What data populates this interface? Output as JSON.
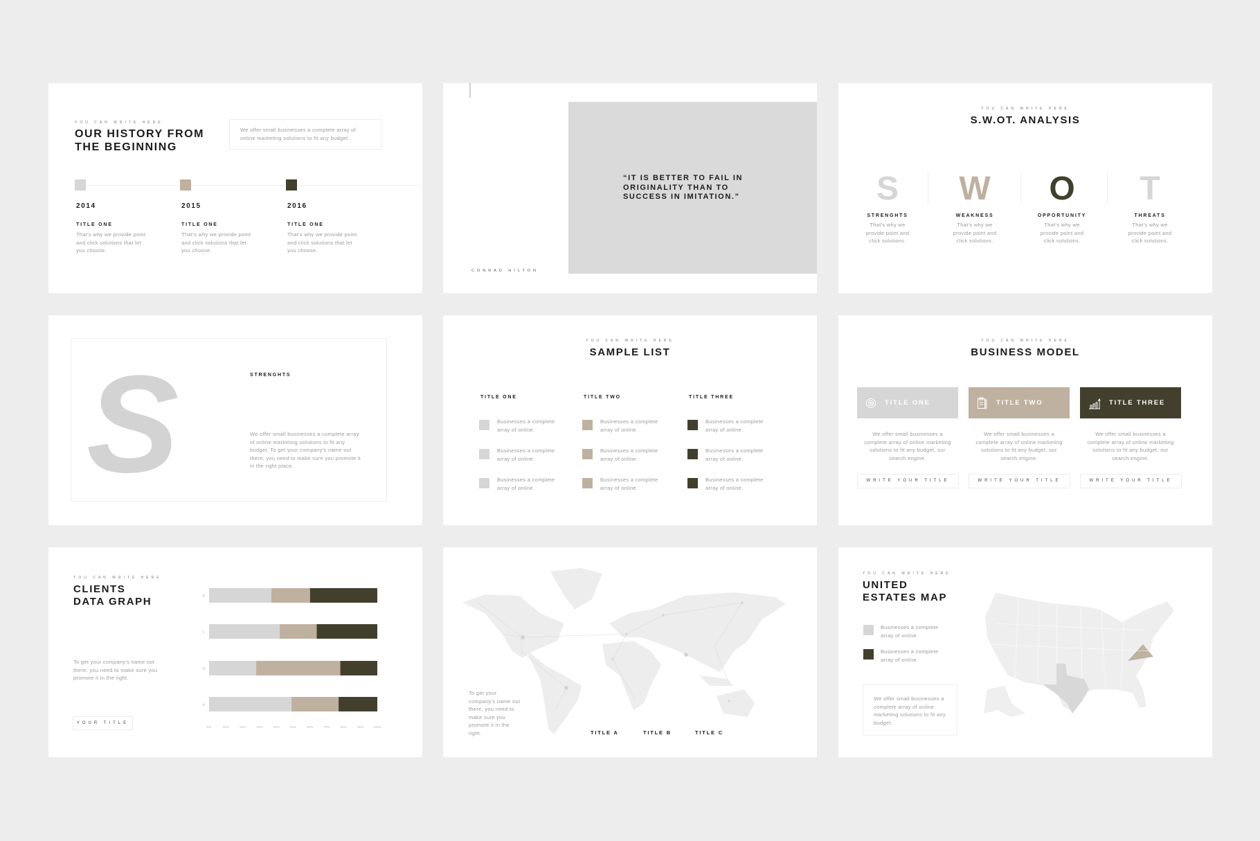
{
  "colors": {
    "background": "#eeedee",
    "light": "#d6d6d6",
    "beige": "#bfb19f",
    "dark": "#423f2d"
  },
  "kicker": "You can write here",
  "history": {
    "title_l1": "Our history from",
    "title_l2": "the beginning",
    "box_text": "We offer small businesses a complete array of online marketing solutions to fit any budget.",
    "items": [
      {
        "year": "2014",
        "title": "Title one",
        "text": "That's why we provide point and click solutions that let you choose."
      },
      {
        "year": "2015",
        "title": "Title one",
        "text": "That's why we provide point and click solutions that let you choose."
      },
      {
        "year": "2016",
        "title": "Title one",
        "text": "That's why we provide point and click solutions that let you choose."
      }
    ]
  },
  "quote": {
    "text": "“It is better to fail in originality than to success in imitation.”",
    "author": "Conrad Hilton"
  },
  "swot": {
    "title": "S.W.OT. Analysis",
    "items": [
      {
        "letter": "S",
        "label": "Strenghts",
        "text": "That's why we provide point and click solutions."
      },
      {
        "letter": "W",
        "label": "Weakness",
        "text": "That's why we provide point and click solutions."
      },
      {
        "letter": "O",
        "label": "Opportunity",
        "text": "That's why we provide point and click solutions."
      },
      {
        "letter": "T",
        "label": "Threats",
        "text": "That's why we provide point and click solutions."
      }
    ]
  },
  "strength": {
    "letter": "S",
    "label": "Strenghts",
    "text": "We offer small businesses a complete array of online marketing solutions to fit any budget. To get your company's name out there, you need to make sure you promote it in the right place."
  },
  "sample_list": {
    "title": "Sample list",
    "columns": [
      {
        "title": "Title one",
        "items": [
          "Businesses a complete array of online.",
          "Businesses a complete array of online.",
          "Businesses a complete array of online."
        ]
      },
      {
        "title": "Title two",
        "items": [
          "Businesses a complete array of online.",
          "Businesses a complete array of online.",
          "Businesses a complete array of online."
        ]
      },
      {
        "title": "Title three",
        "items": [
          "Businesses a complete array of online.",
          "Businesses a complete array of online.",
          "Businesses a complete array of online."
        ]
      }
    ]
  },
  "business": {
    "title": "Business model",
    "cards": [
      {
        "title": "Title one",
        "icon": "target-icon",
        "text": "We offer small businesses a complete array of online marketing solutions to fit any budget, our search engine.",
        "button": "Write your title"
      },
      {
        "title": "Title two",
        "icon": "clipboard-icon",
        "text": "We offer small businesses a complete array of online marketing solutions to fit any budget, our search engine.",
        "button": "Write your title"
      },
      {
        "title": "Title three",
        "icon": "bar-chart-icon",
        "text": "We offer small businesses a complete array of online marketing solutions to fit any budget, our search engine.",
        "button": "Write your title"
      }
    ]
  },
  "clients": {
    "title_l1": "Clients",
    "title_l2": "Data graph",
    "text": "To get your company's name out there, you need to make sure you promote it in the right.",
    "button": "Your title"
  },
  "chart_data": {
    "type": "bar",
    "orientation": "horizontal",
    "stacked": true,
    "categories": [
      "D",
      "C",
      "B",
      "A"
    ],
    "series": [
      {
        "color": "#d6d6d6",
        "values": [
          37,
          42,
          28,
          49
        ]
      },
      {
        "color": "#bfb19f",
        "values": [
          23,
          22,
          50,
          28
        ]
      },
      {
        "color": "#423f2d",
        "values": [
          40,
          36,
          22,
          23
        ]
      }
    ],
    "xticks": [
      "0%",
      "10%",
      "20%",
      "30%",
      "40%",
      "50%",
      "60%",
      "70%",
      "80%",
      "90%",
      "100%"
    ],
    "xlim": [
      0,
      100
    ],
    "grid": false
  },
  "world": {
    "text": "To get your company's name out there, you need to make sure you promote it in the right.",
    "titles": [
      "Title A",
      "Title B",
      "Title C"
    ]
  },
  "usmap": {
    "title_l1": "United",
    "title_l2": "Estates map",
    "legend": [
      "Businesses a complete array of online.",
      "Businesses a complete array of online."
    ],
    "box_text": "We offer small businesses a complete array of online marketing solutions to fit any budget."
  }
}
